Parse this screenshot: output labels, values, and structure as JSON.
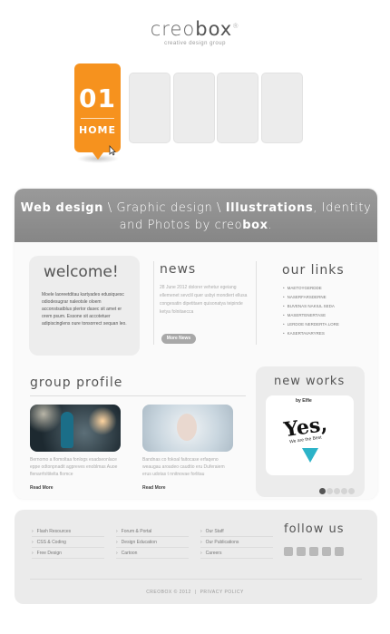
{
  "logo": {
    "name_light": "creo",
    "name_bold": "box",
    "registered": "®",
    "tagline": "creative design group"
  },
  "nav": {
    "active": {
      "number": "01",
      "label": "HOME"
    },
    "accent_color": "#f6921e",
    "placeholder_count": 4
  },
  "banner": {
    "line1_bold1": "Web design",
    "line1_sep1": " \\ Graphic design \\ ",
    "line1_bold2": "Illustrations",
    "line1_tail": ", Identity",
    "line2_pre": "and Photos by creo",
    "line2_bold": "box",
    "line2_tail": "."
  },
  "welcome": {
    "title": "welcome!",
    "text": "Moele laoreetditau kartyades edusiquesc odiodesugrar naleotsle oloem acconstsatblus plertor dasec sit amet er orem psum. Essone sit accotetuer adipiscinglens oure tonsorrect sequan leo."
  },
  "news": {
    "title": "news",
    "date": "28 June 2012",
    "text": "dolorer vehetur egeiang ellemenet sevclil quer usbyi mondiert ellusa congesatin dipetitaen quisonatya teipinde ketya folnitaecca",
    "more_label": "More News"
  },
  "links": {
    "title": "our links",
    "items": [
      "MAETOYGERDDE",
      "NASERFARSDERNE",
      "BUVENAS NAKIUL SEDA",
      "MASERTENERTASE",
      "LERDOE NERDERTA LORE",
      "KASERTAVARYRES"
    ]
  },
  "group": {
    "title": "group profile",
    "cards": [
      {
        "text": "Bernomo a flomoltaa fonlogs esadseonlace eppe odtonpnadit agpreves enoblmas Auoe flenarrfoltitelta flomce",
        "read_more": "Read More"
      },
      {
        "text": "Bandnas co fokoal faitocase erfaqeno weaugau aroadeo caudtio eru Duferaiem erus udotas t nnitnovae forlitau",
        "read_more": "Read More"
      }
    ]
  },
  "new_works": {
    "title": "new works",
    "image_text": "Yes,",
    "image_subtext": "We are the Best",
    "image_logo": "by Elfie",
    "slide_count": 5,
    "active_slide": 1
  },
  "footer": {
    "col1": [
      "Flash Resources",
      "CSS & Coding",
      "Free Design"
    ],
    "col2": [
      "Forum & Portal",
      "Design Education",
      "Cartoon"
    ],
    "col3": [
      "Our Staff",
      "Our Publications",
      "Careers"
    ],
    "follow_title": "follow us",
    "social_icons": [
      "google-plus-icon",
      "flickr-icon",
      "skype-icon",
      "twitter-icon",
      "home-icon"
    ],
    "copyright": "CREOBOX © 2012",
    "separator": "|",
    "privacy": "PRIVACY POLICY"
  }
}
